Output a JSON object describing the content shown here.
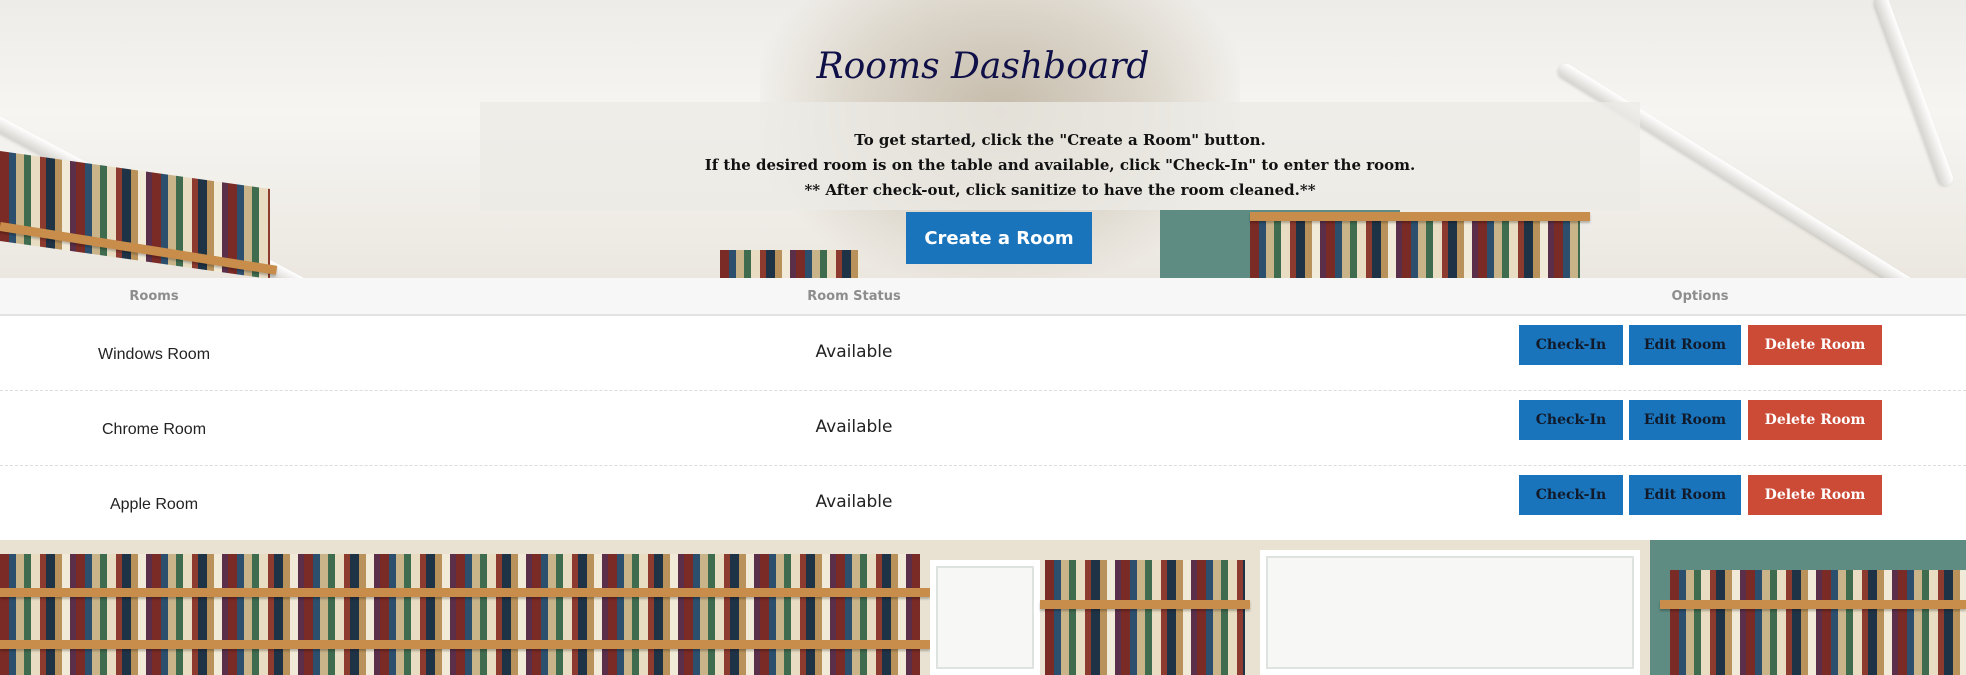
{
  "header": {
    "title": "Rooms Dashboard",
    "instructions": [
      "To get started, click the \"Create a Room\" button.",
      "If the desired room is on the table and available, click \"Check-In\" to enter the room.",
      "** After check-out, click sanitize to have the room cleaned.**"
    ],
    "create_button_label": "Create a Room"
  },
  "table": {
    "columns": [
      "Rooms",
      "Room Status",
      "Options"
    ],
    "rows": [
      {
        "name": "Windows Room",
        "status": "Available"
      },
      {
        "name": "Chrome Room",
        "status": "Available"
      },
      {
        "name": "Apple Room",
        "status": "Available"
      }
    ],
    "actions": {
      "checkin_label": "Check-In",
      "edit_label": "Edit Room",
      "delete_label": "Delete Room"
    }
  },
  "colors": {
    "title": "#101048",
    "primary_button": "#1a74bb",
    "danger_button": "#cc4b37",
    "header_text": "#8d8d8d"
  }
}
